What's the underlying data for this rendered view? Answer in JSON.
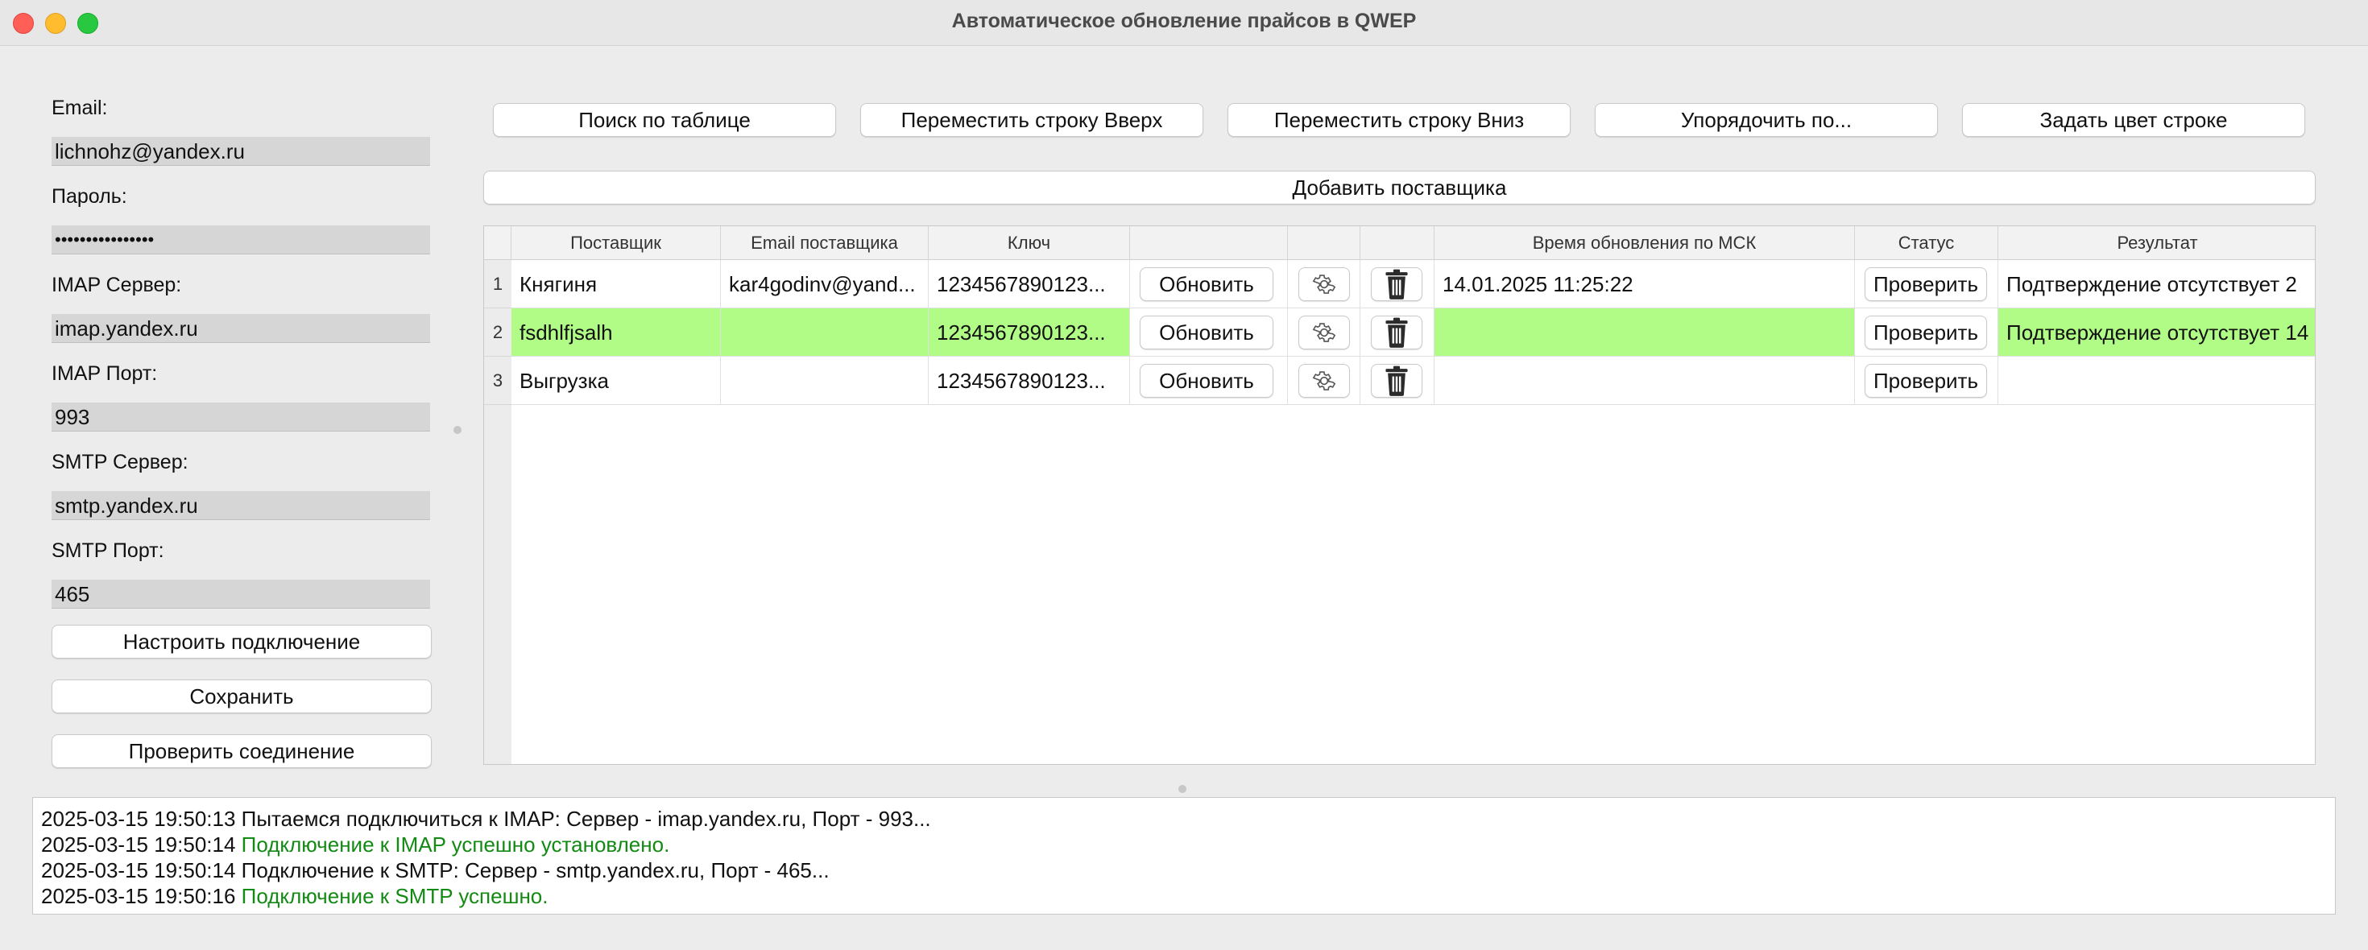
{
  "window": {
    "title": "Автоматическое обновление прайсов в QWEP"
  },
  "settings": {
    "email_label": "Email:",
    "email_value": "lichnohz@yandex.ru",
    "password_label": "Пароль:",
    "password_value": "••••••••••••••••",
    "imap_server_label": "IMAP Сервер:",
    "imap_server_value": "imap.yandex.ru",
    "imap_port_label": "IMAP Порт:",
    "imap_port_value": "993",
    "smtp_server_label": "SMTP Сервер:",
    "smtp_server_value": "smtp.yandex.ru",
    "smtp_port_label": "SMTP Порт:",
    "smtp_port_value": "465",
    "configure_label": "Настроить подключение",
    "save_label": "Сохранить",
    "check_connection_label": "Проверить соединение"
  },
  "toolbar": {
    "search_label": "Поиск по таблице",
    "move_up_label": "Переместить строку Вверх",
    "move_down_label": "Переместить строку Вниз",
    "sort_label": "Упорядочить по...",
    "row_color_label": "Задать цвет строке",
    "add_supplier_label": "Добавить поставщика"
  },
  "table": {
    "columns": [
      "Поставщик",
      "Email поставщика",
      "Ключ",
      "",
      "",
      "",
      "Время обновления по МСК",
      "Статус",
      "Результат"
    ],
    "update_label": "Обновить",
    "check_label": "Проверить",
    "rows": [
      {
        "num": "1",
        "supplier": "Княгиня",
        "email": "kar4godinv@yand...",
        "key": "1234567890123...",
        "time": "14.01.2025 11:25:22",
        "result": "Подтверждение отсутствует 2",
        "highlight": false
      },
      {
        "num": "2",
        "supplier": "fsdhlfjsalh",
        "email": "",
        "key": "1234567890123...",
        "time": "",
        "result": "Подтверждение отсутствует 14",
        "highlight": true
      },
      {
        "num": "3",
        "supplier": "Выгрузка",
        "email": "",
        "key": "1234567890123...",
        "time": "",
        "result": "",
        "highlight": false
      }
    ],
    "highlight_color": "#b1fc86"
  },
  "log": {
    "lines": [
      {
        "ts": "2025-03-15 19:50:13",
        "msg": "Пытаемся подключиться к IMAP: Сервер - imap.yandex.ru, Порт - 993...",
        "ok": false
      },
      {
        "ts": "2025-03-15 19:50:14",
        "msg": "Подключение к IMAP успешно установлено.",
        "ok": true
      },
      {
        "ts": "2025-03-15 19:50:14",
        "msg": "Подключение к SMTP: Сервер - smtp.yandex.ru, Порт - 465...",
        "ok": false
      },
      {
        "ts": "2025-03-15 19:50:16",
        "msg": "Подключение к SMTP успешно.",
        "ok": true
      }
    ],
    "success_color": "#138a13"
  }
}
